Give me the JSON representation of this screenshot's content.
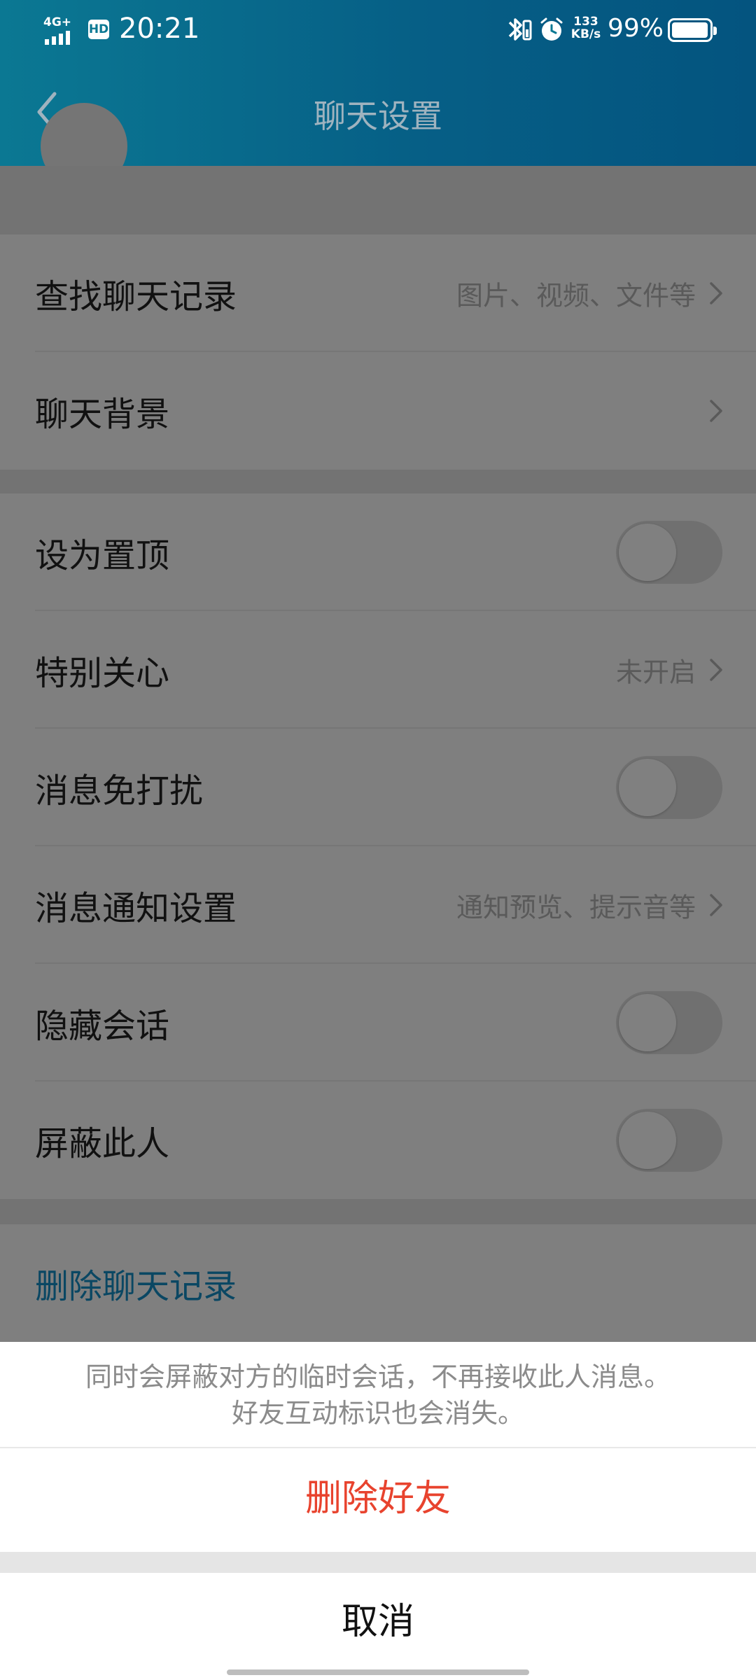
{
  "status_bar": {
    "network": "4G+",
    "hd": "HD",
    "time": "20:21",
    "speed_value": "133",
    "speed_unit": "KB/s",
    "battery_percent": "99%",
    "battery_level": 0.99
  },
  "header": {
    "title": "聊天设置"
  },
  "settings": {
    "search_history": {
      "label": "查找聊天记录",
      "value": "图片、视频、文件等"
    },
    "chat_background": {
      "label": "聊天背景"
    },
    "pin_top": {
      "label": "设为置顶",
      "on": false
    },
    "special_care": {
      "label": "特别关心",
      "value": "未开启"
    },
    "mute": {
      "label": "消息免打扰",
      "on": false
    },
    "notification": {
      "label": "消息通知设置",
      "value": "通知预览、提示音等"
    },
    "hide_chat": {
      "label": "隐藏会话",
      "on": false
    },
    "block": {
      "label": "屏蔽此人",
      "on": false
    },
    "delete_history": {
      "label": "删除聊天记录"
    }
  },
  "sheet": {
    "message_line1": "同时会屏蔽对方的临时会话，不再接收此人消息。",
    "message_line2": "好友互动标识也会消失。",
    "delete_friend": "删除好友",
    "cancel": "取消"
  },
  "colors": {
    "header_start": "#0b7893",
    "header_end": "#04547f",
    "destructive": "#e8432e",
    "link": "#0a4763"
  }
}
